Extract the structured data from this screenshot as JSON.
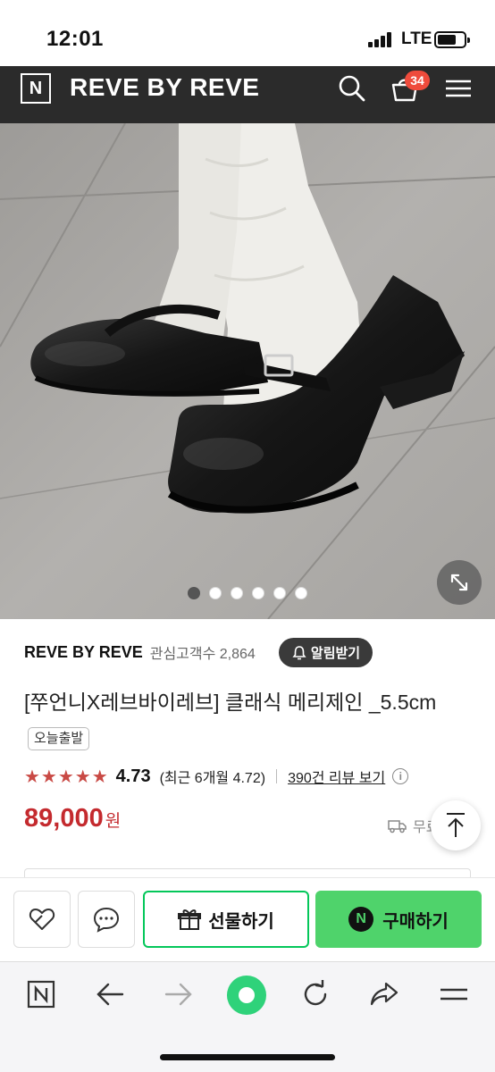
{
  "status_bar": {
    "time": "12:01",
    "network": "LTE"
  },
  "header": {
    "logo_letter": "N",
    "brand": "REVE BY REVE",
    "cart_count": "34"
  },
  "hero": {
    "slide_count": 6,
    "active_slide": 1
  },
  "product": {
    "seller": "REVE BY REVE",
    "favorites_label": "관심고객수 2,864",
    "notify_label": "알림받기",
    "title": "[쭈언니X레브바이레브] 클래식 메리제인 _5.5cm",
    "shipping_tag": "오늘출발",
    "stars": "★★★★★",
    "rating": "4.73",
    "rating_recent": "(최근 6개월 4.72)",
    "review_link": "390건 리뷰 보기",
    "info_glyph": "i",
    "price": "89,000",
    "price_unit": "원",
    "delivery_text": "무료"
  },
  "buy_bar": {
    "gift_label": "선물하기",
    "buy_label": "구매하기",
    "npay_letter": "N"
  },
  "browser": {
    "logo_letter": "N"
  },
  "colors": {
    "header_bg": "#2b2b2b",
    "price": "#c42a2e",
    "buy_green": "#4fd36b",
    "badge_red": "#ef4b3c"
  }
}
